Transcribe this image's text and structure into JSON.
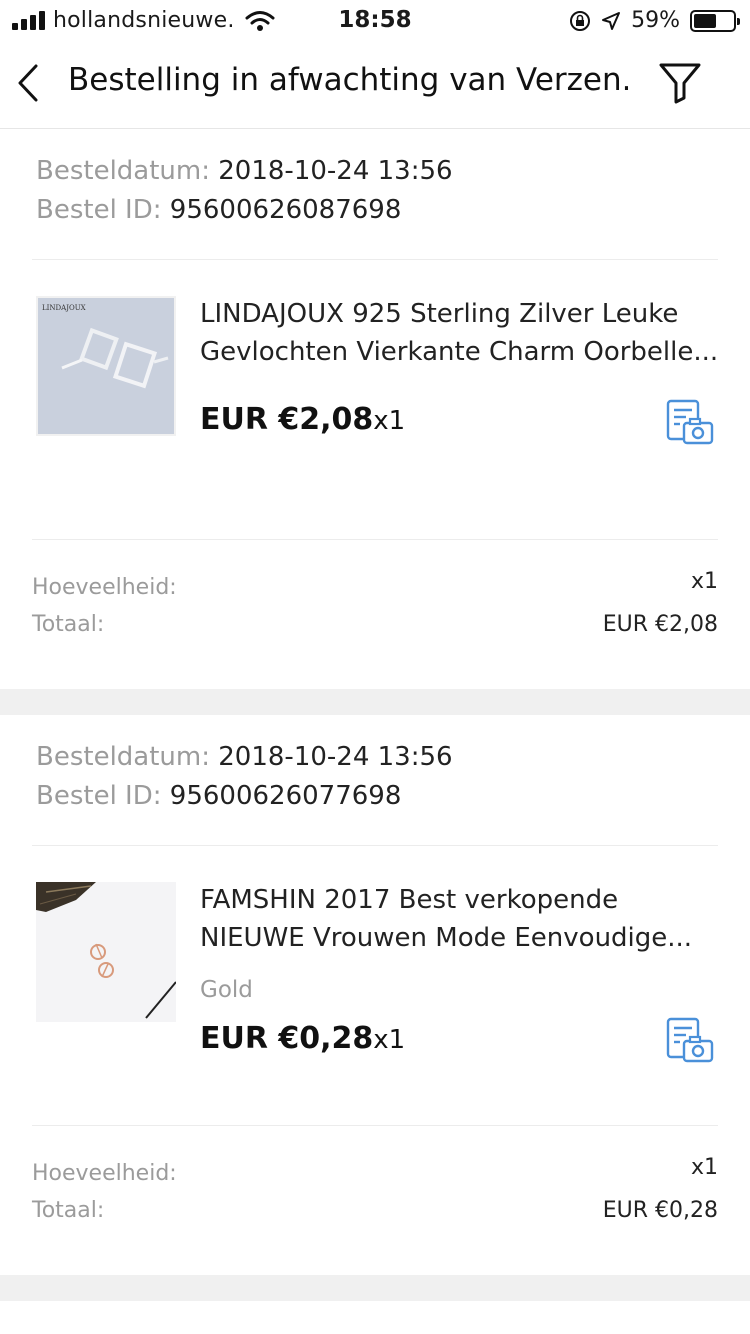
{
  "status_bar": {
    "carrier": "hollandsnieuwe.",
    "time": "18:58",
    "battery": "59%",
    "battery_level": 0.59
  },
  "nav": {
    "title": "Bestelling in afwachting van Verzen...",
    "back_icon": "chevron-left-icon",
    "filter_icon": "filter-icon"
  },
  "labels": {
    "order_date": "Besteldatum:",
    "order_id": "Bestel ID:",
    "quantity": "Hoeveelheid:",
    "total": "Totaal:"
  },
  "orders": [
    {
      "date": "2018-10-24 13:56",
      "id": "95600626087698",
      "thumb_brand": "LINDAJOUX",
      "title_line1": "LINDAJOUX 925 Sterling Zilver Leuke",
      "title_line2": "Gevlochten Vierkante Charm Oorbelle...",
      "variant": "",
      "price": "EUR €2,08",
      "qty": "x1",
      "quantity_value": "x1",
      "total_value": "EUR €2,08"
    },
    {
      "date": "2018-10-24 13:56",
      "id": "95600626077698",
      "title_line1": "FAMSHIN 2017 Best verkopende",
      "title_line2": "NIEUWE Vrouwen Mode Eenvoudige...",
      "variant": "Gold",
      "price": "EUR €0,28",
      "qty": "x1",
      "quantity_value": "x1",
      "total_value": "EUR €0,28"
    }
  ],
  "colors": {
    "accent_icon": "#4a90d9",
    "label_gray": "#9b9b9b",
    "divider": "#ececec",
    "section_gap": "#f0f0f0"
  }
}
